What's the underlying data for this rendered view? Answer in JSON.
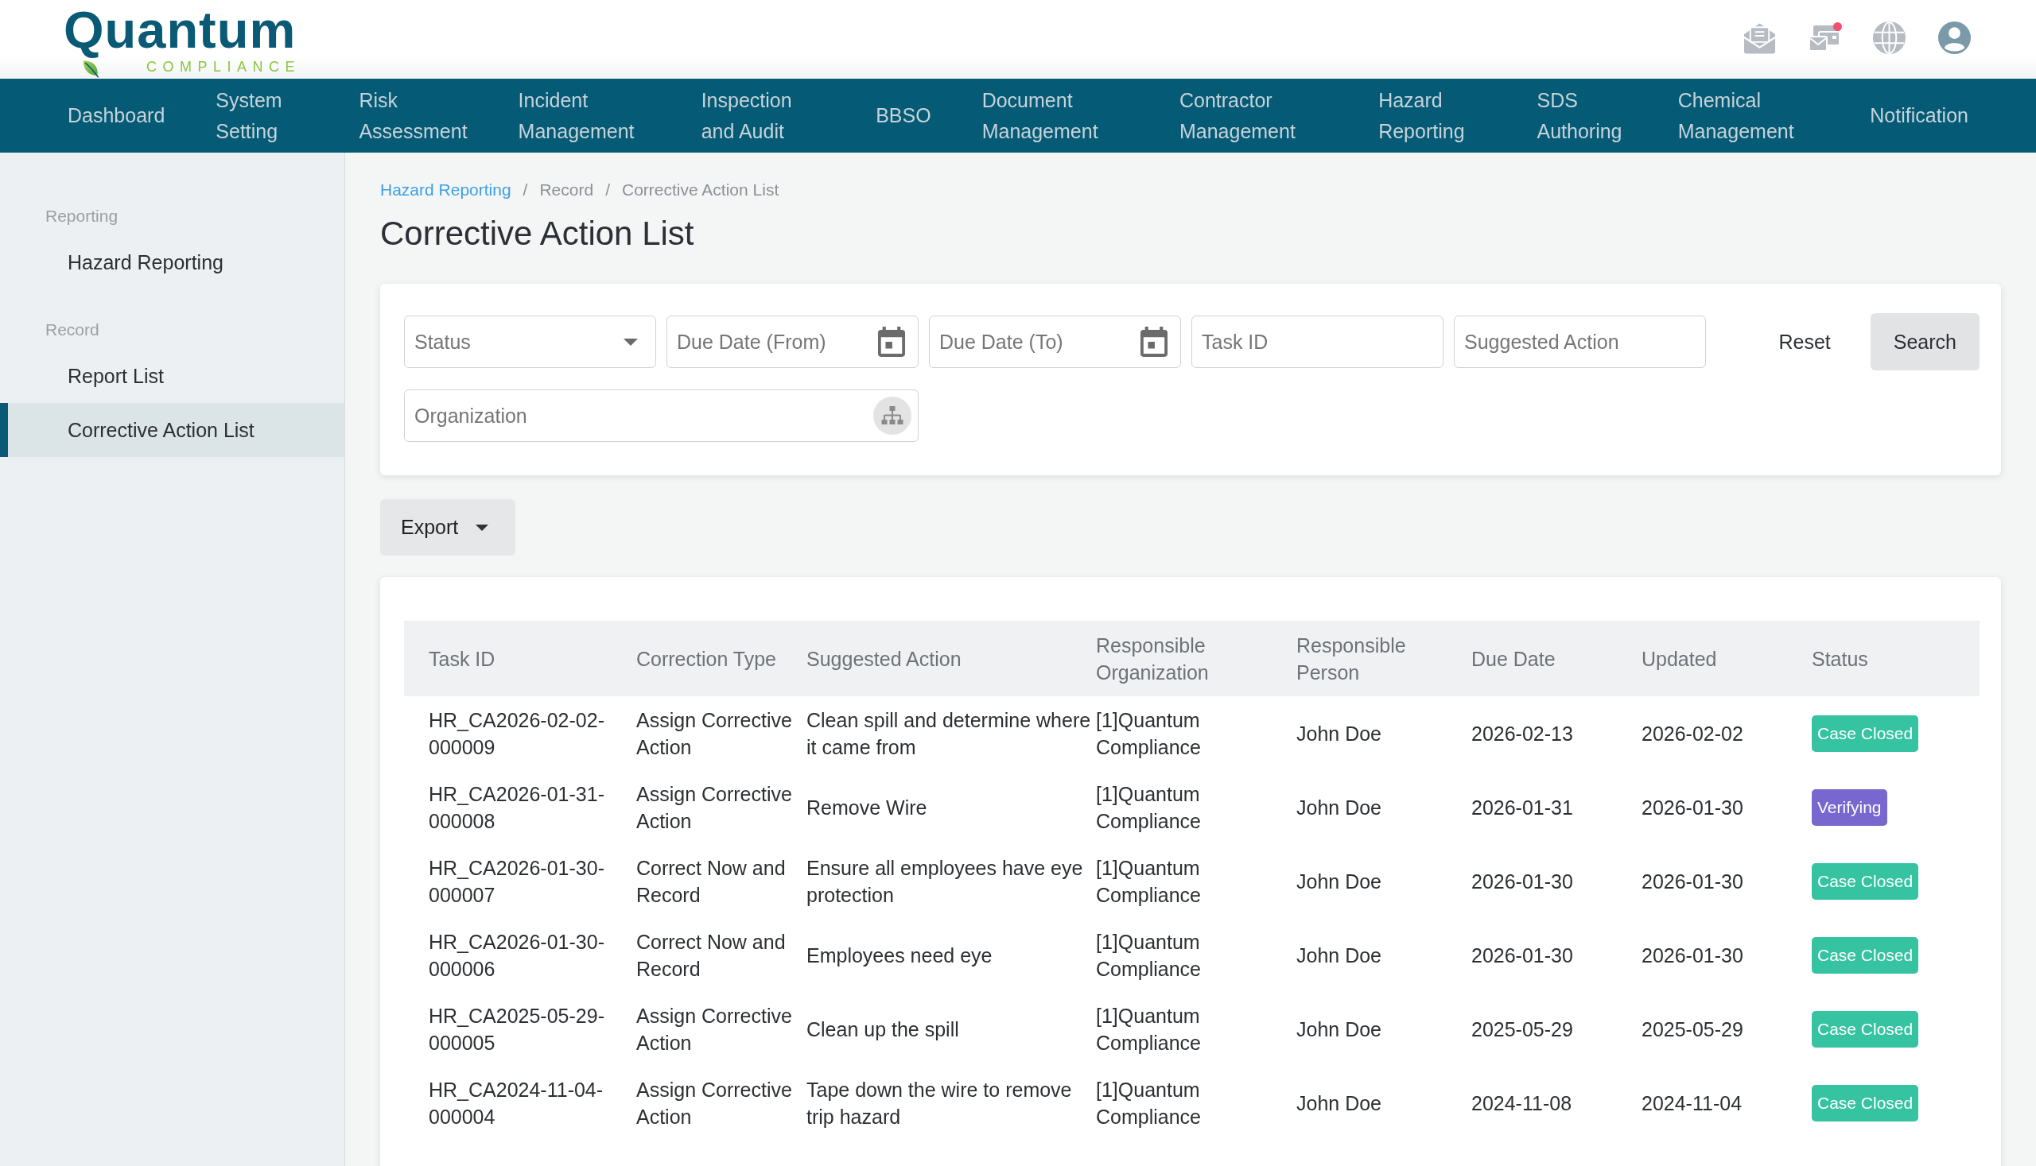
{
  "header": {
    "logo": {
      "wordmark": "Quantum",
      "tagline": "COMPLIANCE"
    },
    "has_notification": true
  },
  "nav": {
    "items": [
      {
        "label": "Dashboard"
      },
      {
        "label": "System Setting"
      },
      {
        "label": "Risk Assessment"
      },
      {
        "label": "Incident Management"
      },
      {
        "label": "Inspection and Audit"
      },
      {
        "label": "BBSO"
      },
      {
        "label": "Document Management"
      },
      {
        "label": "Contractor Management"
      },
      {
        "label": "Hazard Reporting"
      },
      {
        "label": "SDS Authoring"
      },
      {
        "label": "Chemical Management"
      },
      {
        "label": "Notification"
      }
    ]
  },
  "sidebar": {
    "sections": [
      {
        "title": "Reporting",
        "items": [
          {
            "label": "Hazard Reporting",
            "selected": false
          }
        ]
      },
      {
        "title": "Record",
        "items": [
          {
            "label": "Report List",
            "selected": false
          },
          {
            "label": "Corrective Action List",
            "selected": true
          }
        ]
      }
    ]
  },
  "breadcrumb": {
    "items": [
      {
        "kind": "link",
        "label": "Hazard Reporting"
      },
      {
        "kind": "separator",
        "label": "/"
      },
      {
        "kind": "page",
        "label": "Record"
      },
      {
        "kind": "separator",
        "label": "/"
      },
      {
        "kind": "page",
        "label": "Corrective Action List"
      }
    ]
  },
  "page_title": "Corrective Action List",
  "filters": {
    "fields": [
      {
        "kind": "select",
        "placeholder": "Status"
      },
      {
        "kind": "date",
        "placeholder": "Due Date (From)"
      },
      {
        "kind": "date",
        "placeholder": "Due Date (To)"
      },
      {
        "kind": "text",
        "placeholder": "Task ID"
      },
      {
        "kind": "text",
        "placeholder": "Suggested Action"
      },
      {
        "kind": "organization",
        "placeholder": "Organization"
      }
    ],
    "buttons": [
      {
        "kind": "reset",
        "label": "Reset"
      },
      {
        "kind": "search",
        "label": "Search"
      }
    ]
  },
  "export_button": {
    "label": "Export"
  },
  "table": {
    "columns": [
      "Task ID",
      "Correction Type",
      "Suggested Action",
      "Responsible Organization",
      "Responsible Person",
      "Due Date",
      "Updated",
      "Status"
    ],
    "rows": [
      {
        "cells": [
          "HR_CA2026-02-02-000009",
          "Assign Corrective Action",
          "Clean spill and determine where it came from",
          "[1]Quantum Compliance",
          "John Doe",
          "2026-02-13",
          "2026-02-02"
        ],
        "status": {
          "label": "Case Closed",
          "color": "#35c3a1"
        }
      },
      {
        "cells": [
          "HR_CA2026-01-31-000008",
          "Assign Corrective Action",
          "Remove Wire",
          "[1]Quantum Compliance",
          "John Doe",
          "2026-01-31",
          "2026-01-30"
        ],
        "status": {
          "label": "Verifying",
          "color": "#7767cf"
        }
      },
      {
        "cells": [
          "HR_CA2026-01-30-000007",
          "Correct Now and Record",
          "Ensure all employees have eye protection",
          "[1]Quantum Compliance",
          "John Doe",
          "2026-01-30",
          "2026-01-30"
        ],
        "status": {
          "label": "Case Closed",
          "color": "#35c3a1"
        }
      },
      {
        "cells": [
          "HR_CA2026-01-30-000006",
          "Correct Now and Record",
          "Employees need eye",
          "[1]Quantum Compliance",
          "John Doe",
          "2026-01-30",
          "2026-01-30"
        ],
        "status": {
          "label": "Case Closed",
          "color": "#35c3a1"
        }
      },
      {
        "cells": [
          "HR_CA2025-05-29-000005",
          "Assign Corrective Action",
          "Clean up the spill",
          "[1]Quantum Compliance",
          "John Doe",
          "2025-05-29",
          "2025-05-29"
        ],
        "status": {
          "label": "Case Closed",
          "color": "#35c3a1"
        }
      },
      {
        "cells": [
          "HR_CA2024-11-04-000004",
          "Assign Corrective Action",
          "Tape down the wire to remove trip hazard",
          "[1]Quantum Compliance",
          "John Doe",
          "2024-11-08",
          "2024-11-04"
        ],
        "status": {
          "label": "Case Closed",
          "color": "#35c3a1"
        }
      }
    ]
  }
}
